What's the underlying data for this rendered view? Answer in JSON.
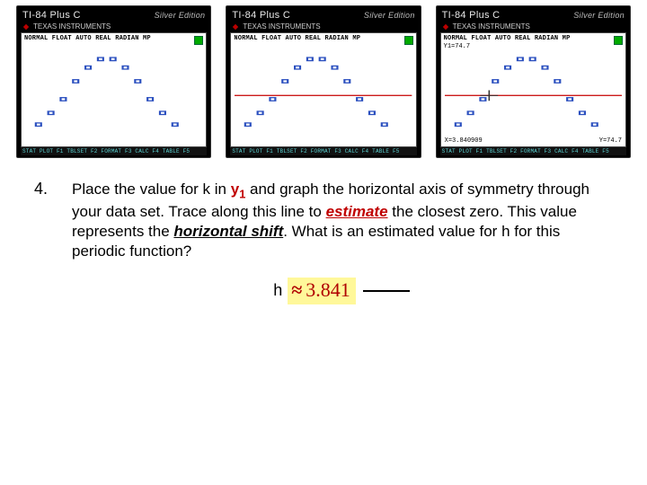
{
  "calc": {
    "model": "TI-84 Plus C",
    "edition": "Silver Edition",
    "logo": "TEXAS INSTRUMENTS",
    "softkeys": "STAT PLOT F1  TBLSET F2  FORMAT F3  CALC F4  TABLE F5"
  },
  "screens": {
    "left": {
      "mode": "NORMAL FLOAT AUTO REAL RADIAN MP",
      "eqn": "",
      "show_hline": false,
      "show_cursor": false,
      "readout_x": "",
      "readout_y": ""
    },
    "mid": {
      "mode": "NORMAL FLOAT AUTO REAL RADIAN MP",
      "eqn": "",
      "show_hline": true,
      "show_cursor": false,
      "readout_x": "",
      "readout_y": ""
    },
    "right": {
      "mode": "NORMAL FLOAT AUTO REAL RADIAN MP",
      "eqn": "Y1=74.7",
      "show_hline": true,
      "show_cursor": true,
      "readout_x": "X=3.840909",
      "readout_y": "Y=74.7"
    }
  },
  "chart_data": {
    "type": "scatter",
    "title": "",
    "xlabel": "",
    "ylabel": "",
    "xlim": [
      0,
      13
    ],
    "ylim": [
      50,
      100
    ],
    "hline": 74.7,
    "series": [
      {
        "name": "data",
        "x": [
          1,
          2,
          3,
          4,
          5,
          6,
          7,
          8,
          9,
          10,
          11,
          12
        ],
        "y": [
          55,
          63,
          73,
          83,
          91,
          96,
          96,
          91,
          83,
          73,
          63,
          55
        ]
      }
    ],
    "cursor": {
      "x": 3.841,
      "y": 74.7
    }
  },
  "question": {
    "number": "4.",
    "before_y1": "Place the value for k in ",
    "y1": "y",
    "y1_sub": "1",
    "after_y1": " and graph the horizontal axis of symmetry through your data set. Trace along this line to ",
    "estimate": "estimate",
    "mid1": " the closest zero. This value represents the ",
    "hshift": "horizontal shift",
    "tail": ".  What is an estimated value for h for this periodic function?"
  },
  "answer": {
    "label": "h",
    "symbol": "≈",
    "value": "3.841"
  }
}
